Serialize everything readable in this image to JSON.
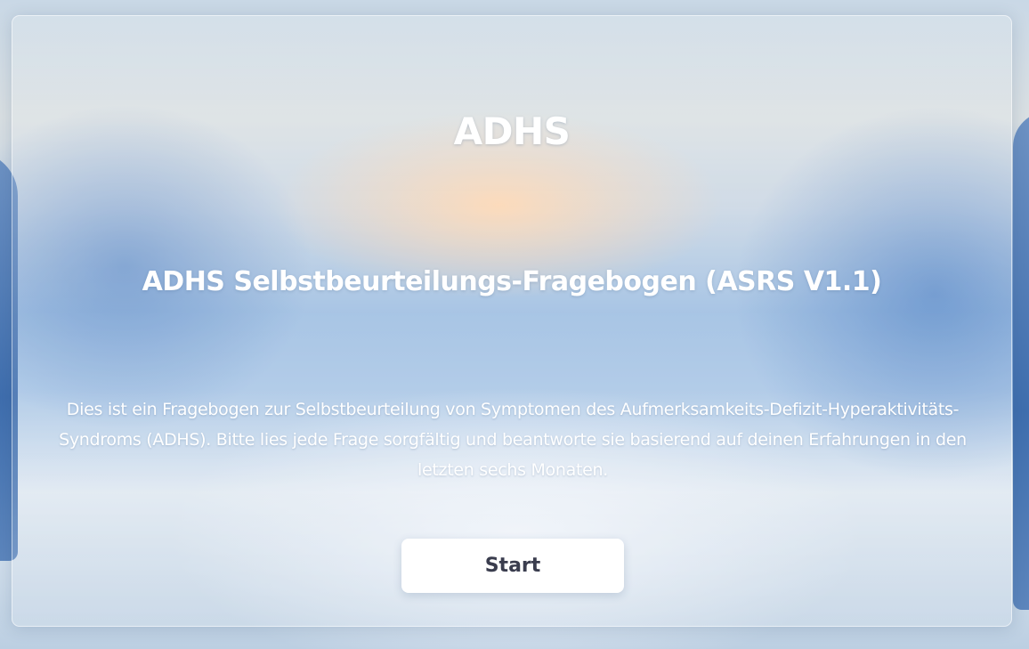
{
  "intro": {
    "title": "ADHS",
    "subtitle": "ADHS Selbstbeurteilungs-Fragebogen (ASRS V1.1)",
    "description": "Dies ist ein Fragebogen zur Selbstbeurteilung von Symptomen des Aufmerksamkeits-Defizit-Hyperaktivitäts-Syndroms (ADHS). Bitte lies jede Frage sorgfältig und beantworte sie basierend auf deinen Erfahrungen in den letzten sechs Monaten.",
    "start_label": "Start"
  },
  "colors": {
    "text": "#ffffff",
    "button_background": "#ffffff",
    "button_text": "#3a3d4e"
  }
}
